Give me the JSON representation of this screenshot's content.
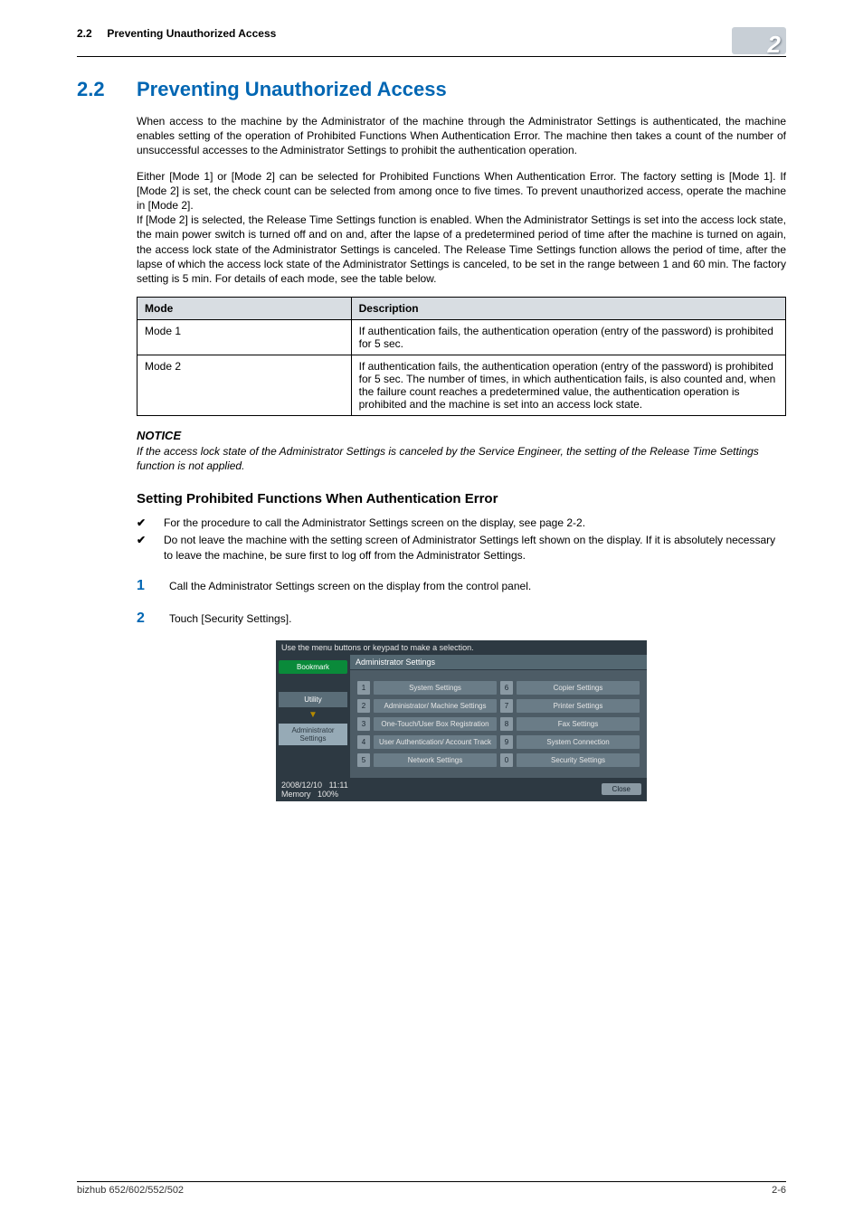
{
  "header": {
    "section_ref": "2.2",
    "running_title": "Preventing Unauthorized Access",
    "chapter_badge": "2"
  },
  "title": {
    "num": "2.2",
    "text": "Preventing Unauthorized Access"
  },
  "paragraphs": {
    "p1": "When access to the machine by the Administrator of the machine through the Administrator Settings is authenticated, the machine enables setting of the operation of Prohibited Functions When Authentication Error. The machine then takes a count of the number of unsuccessful accesses to the Administrator Settings to prohibit the authentication operation.",
    "p2": "Either [Mode 1] or [Mode 2] can be selected for Prohibited Functions When Authentication Error. The factory setting is [Mode 1]. If [Mode 2] is set, the check count can be selected from among once to five times. To prevent unauthorized access, operate the machine in [Mode 2].",
    "p3": "If [Mode 2] is selected, the Release Time Settings function is enabled. When the Administrator Settings is set into the access lock state, the main power switch is turned off and on and, after the lapse of a predetermined period of time after the machine is turned on again, the access lock state of the Administrator Settings is canceled. The Release Time Settings function allows the period of time, after the lapse of which the access lock state of the Administrator Settings is canceled, to be set in the range between 1 and 60 min. The factory setting is 5 min. For details of each mode, see the table below."
  },
  "table": {
    "head_mode": "Mode",
    "head_desc": "Description",
    "rows": [
      {
        "mode": "Mode 1",
        "desc": "If authentication fails, the authentication operation (entry of the password) is prohibited for 5 sec."
      },
      {
        "mode": "Mode 2",
        "desc": "If authentication fails, the authentication operation (entry of the password) is prohibited for 5 sec. The number of times, in which authentication fails, is also counted and, when the failure count reaches a predetermined value, the authentication operation is prohibited and the machine is set into an access lock state."
      }
    ]
  },
  "notice": {
    "heading": "NOTICE",
    "body": "If the access lock state of the Administrator Settings is canceled by the Service Engineer, the setting of the Release Time Settings function is not applied."
  },
  "subsection": {
    "heading": "Setting Prohibited Functions When Authentication Error",
    "checks": [
      "For the procedure to call the Administrator Settings screen on the display, see page 2-2.",
      "Do not leave the machine with the setting screen of Administrator Settings left shown on the display. If it is absolutely necessary to leave the machine, be sure first to log off from the Administrator Settings."
    ],
    "steps": [
      "Call the Administrator Settings screen on the display from the control panel.",
      "Touch [Security Settings]."
    ]
  },
  "ui": {
    "instruction": "Use the menu buttons or keypad to make a selection.",
    "bookmark": "Bookmark",
    "panel_title": "Administrator Settings",
    "utility": "Utility",
    "admin_crumb": "Administrator Settings",
    "buttons": [
      {
        "n": "1",
        "label": "System Settings"
      },
      {
        "n": "2",
        "label": "Administrator/ Machine Settings"
      },
      {
        "n": "3",
        "label": "One-Touch/User Box Registration"
      },
      {
        "n": "4",
        "label": "User Authentication/ Account Track"
      },
      {
        "n": "5",
        "label": "Network Settings"
      },
      {
        "n": "6",
        "label": "Copier Settings"
      },
      {
        "n": "7",
        "label": "Printer Settings"
      },
      {
        "n": "8",
        "label": "Fax Settings"
      },
      {
        "n": "9",
        "label": "System Connection"
      },
      {
        "n": "0",
        "label": "Security Settings"
      }
    ],
    "status_date": "2008/12/10",
    "status_time": "11:11",
    "status_mem_label": "Memory",
    "status_mem_val": "100%",
    "close": "Close"
  },
  "footer": {
    "left": "bizhub 652/602/552/502",
    "right": "2-6"
  }
}
